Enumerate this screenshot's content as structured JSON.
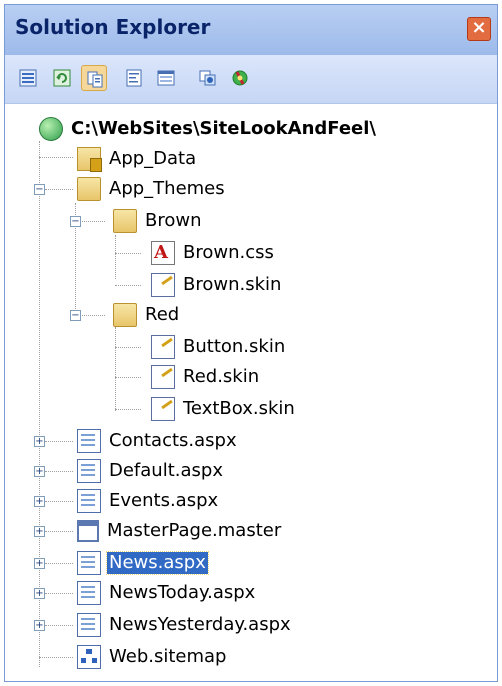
{
  "window": {
    "title": "Solution Explorer",
    "close_glyph": "×"
  },
  "toolbar": {
    "buttons": [
      {
        "name": "properties-icon",
        "active": false
      },
      {
        "name": "refresh-icon",
        "active": false
      },
      {
        "name": "show-all-files-icon",
        "active": true
      },
      {
        "name": "view-code-icon",
        "active": false
      },
      {
        "name": "view-designer-icon",
        "active": false
      },
      {
        "name": "copy-web-site-icon",
        "active": false
      },
      {
        "name": "asp-net-configuration-icon",
        "active": false
      }
    ]
  },
  "tree": {
    "root": "C:\\WebSites\\SiteLookAndFeel\\",
    "items": [
      {
        "label": "App_Data",
        "icon": "app-data-folder-icon"
      },
      {
        "label": "App_Themes",
        "icon": "folder-icon",
        "expanded": true
      },
      {
        "label": "Brown",
        "icon": "folder-icon",
        "expanded": true
      },
      {
        "label": "Brown.css",
        "icon": "css-file-icon"
      },
      {
        "label": "Brown.skin",
        "icon": "skin-file-icon"
      },
      {
        "label": "Red",
        "icon": "folder-icon",
        "expanded": true
      },
      {
        "label": "Button.skin",
        "icon": "skin-file-icon"
      },
      {
        "label": "Red.skin",
        "icon": "skin-file-icon"
      },
      {
        "label": "TextBox.skin",
        "icon": "skin-file-icon"
      },
      {
        "label": "Contacts.aspx",
        "icon": "aspx-file-icon",
        "expanded": false
      },
      {
        "label": "Default.aspx",
        "icon": "aspx-file-icon",
        "expanded": false
      },
      {
        "label": "Events.aspx",
        "icon": "aspx-file-icon",
        "expanded": false
      },
      {
        "label": "MasterPage.master",
        "icon": "master-page-icon",
        "expanded": false
      },
      {
        "label": "News.aspx",
        "icon": "aspx-file-icon",
        "expanded": false,
        "selected": true
      },
      {
        "label": "NewsToday.aspx",
        "icon": "aspx-file-icon",
        "expanded": false
      },
      {
        "label": "NewsYesterday.aspx",
        "icon": "aspx-file-icon",
        "expanded": false
      },
      {
        "label": "Web.sitemap",
        "icon": "sitemap-file-icon"
      }
    ]
  },
  "colors": {
    "titlebar": "#9dbaea",
    "selection": "#316ac5",
    "close": "#e26b3f"
  }
}
